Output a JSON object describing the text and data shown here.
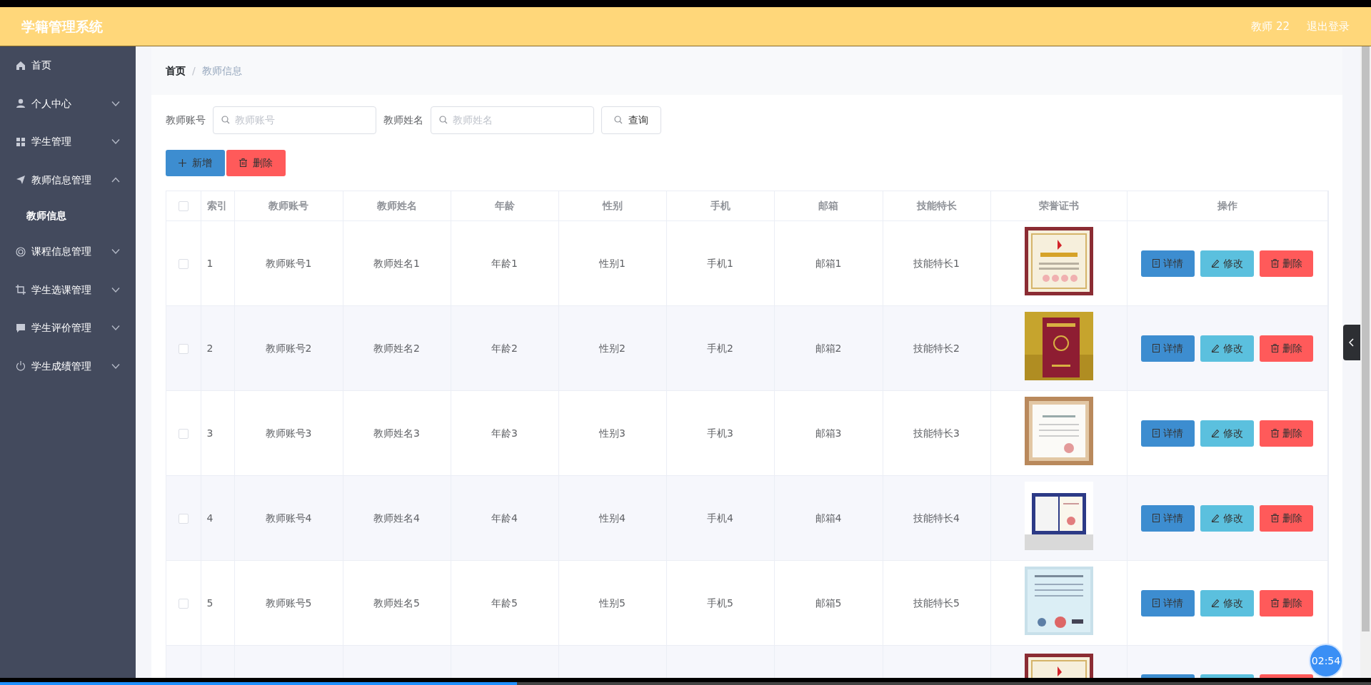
{
  "header": {
    "title": "学籍管理系统",
    "user": "教师 22",
    "logout": "退出登录"
  },
  "sidebar": {
    "items": [
      {
        "label": "首页",
        "collapsible": false
      },
      {
        "label": "个人中心",
        "collapsible": true,
        "expanded": false
      },
      {
        "label": "学生管理",
        "collapsible": true,
        "expanded": false
      },
      {
        "label": "教师信息管理",
        "collapsible": true,
        "expanded": true,
        "children": [
          {
            "label": "教师信息",
            "selected": true
          }
        ]
      },
      {
        "label": "课程信息管理",
        "collapsible": true,
        "expanded": false
      },
      {
        "label": "学生选课管理",
        "collapsible": true,
        "expanded": false
      },
      {
        "label": "学生评价管理",
        "collapsible": true,
        "expanded": false
      },
      {
        "label": "学生成绩管理",
        "collapsible": true,
        "expanded": false
      }
    ]
  },
  "breadcrumb": [
    {
      "label": "首页",
      "current": false
    },
    {
      "separator": "/",
      "label": "教师信息",
      "current": true
    }
  ],
  "search": {
    "fields": [
      {
        "label": "教师账号",
        "placeholder": "教师账号"
      },
      {
        "label": "教师姓名",
        "placeholder": "教师姓名"
      }
    ],
    "button": "查询"
  },
  "toolbar": [
    {
      "label": "新增",
      "kind": "add"
    },
    {
      "label": "删除",
      "kind": "delete"
    }
  ],
  "table": {
    "select_all": {
      "checked": false
    },
    "columns": [
      "索引",
      "教师账号",
      "教师姓名",
      "年龄",
      "性别",
      "手机",
      "邮箱",
      "技能特长",
      "荣誉证书",
      "操作"
    ],
    "rows": [
      {
        "checked": false,
        "cells": [
          "1",
          "教师账号1",
          "教师姓名1",
          "年龄1",
          "性别1",
          "手机1",
          "邮箱1",
          "技能特长1"
        ],
        "actions": [
          {
            "label": "详情",
            "kind": "detail"
          },
          {
            "label": "修改",
            "kind": "edit"
          },
          {
            "label": "删除",
            "kind": "delete"
          }
        ]
      },
      {
        "checked": false,
        "cells": [
          "2",
          "教师账号2",
          "教师姓名2",
          "年龄2",
          "性别2",
          "手机2",
          "邮箱2",
          "技能特长2"
        ],
        "actions": [
          {
            "label": "详情",
            "kind": "detail"
          },
          {
            "label": "修改",
            "kind": "edit"
          },
          {
            "label": "删除",
            "kind": "delete"
          }
        ]
      },
      {
        "checked": false,
        "cells": [
          "3",
          "教师账号3",
          "教师姓名3",
          "年龄3",
          "性别3",
          "手机3",
          "邮箱3",
          "技能特长3"
        ],
        "actions": [
          {
            "label": "详情",
            "kind": "detail"
          },
          {
            "label": "修改",
            "kind": "edit"
          },
          {
            "label": "删除",
            "kind": "delete"
          }
        ]
      },
      {
        "checked": false,
        "cells": [
          "4",
          "教师账号4",
          "教师姓名4",
          "年龄4",
          "性别4",
          "手机4",
          "邮箱4",
          "技能特长4"
        ],
        "actions": [
          {
            "label": "详情",
            "kind": "detail"
          },
          {
            "label": "修改",
            "kind": "edit"
          },
          {
            "label": "删除",
            "kind": "delete"
          }
        ]
      },
      {
        "checked": false,
        "cells": [
          "5",
          "教师账号5",
          "教师姓名5",
          "年龄5",
          "性别5",
          "手机5",
          "邮箱5",
          "技能特长5"
        ],
        "actions": [
          {
            "label": "详情",
            "kind": "detail"
          },
          {
            "label": "修改",
            "kind": "edit"
          },
          {
            "label": "删除",
            "kind": "delete"
          }
        ]
      }
    ],
    "cut_row": {
      "actions": [
        {
          "kind": "detail"
        },
        {
          "kind": "edit"
        },
        {
          "kind": "delete"
        }
      ]
    }
  },
  "recorder": {
    "timer": "02:54",
    "progress": {
      "level": 0.377
    }
  }
}
